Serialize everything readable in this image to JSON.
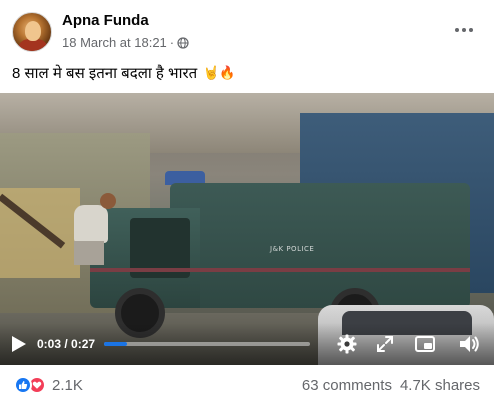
{
  "post": {
    "author": "Apna Funda",
    "date": "18 March at 18:21",
    "separator": "·",
    "privacy_icon": "globe-icon",
    "caption": "8 साल मे बस इतना बदला है भारत",
    "caption_emojis": "🤘🔥"
  },
  "video": {
    "vehicle_text": "J&K POLICE",
    "current_time": "0:03",
    "duration": "0:27",
    "time_display": "0:03 / 0:27",
    "progress": 0.11,
    "icons": [
      "play-icon",
      "settings-gear-icon",
      "fullscreen-expand-icon",
      "picture-in-picture-icon",
      "volume-icon"
    ]
  },
  "footer": {
    "reaction_icons": [
      "like-icon",
      "love-icon"
    ],
    "reaction_count": "2.1K",
    "comments": "63 comments",
    "shares": "4.7K shares"
  },
  "colors": {
    "accent": "#1b74e4",
    "text_primary": "#050505",
    "text_secondary": "#65676b",
    "like": "#1877f2",
    "love": "#f33e58"
  }
}
